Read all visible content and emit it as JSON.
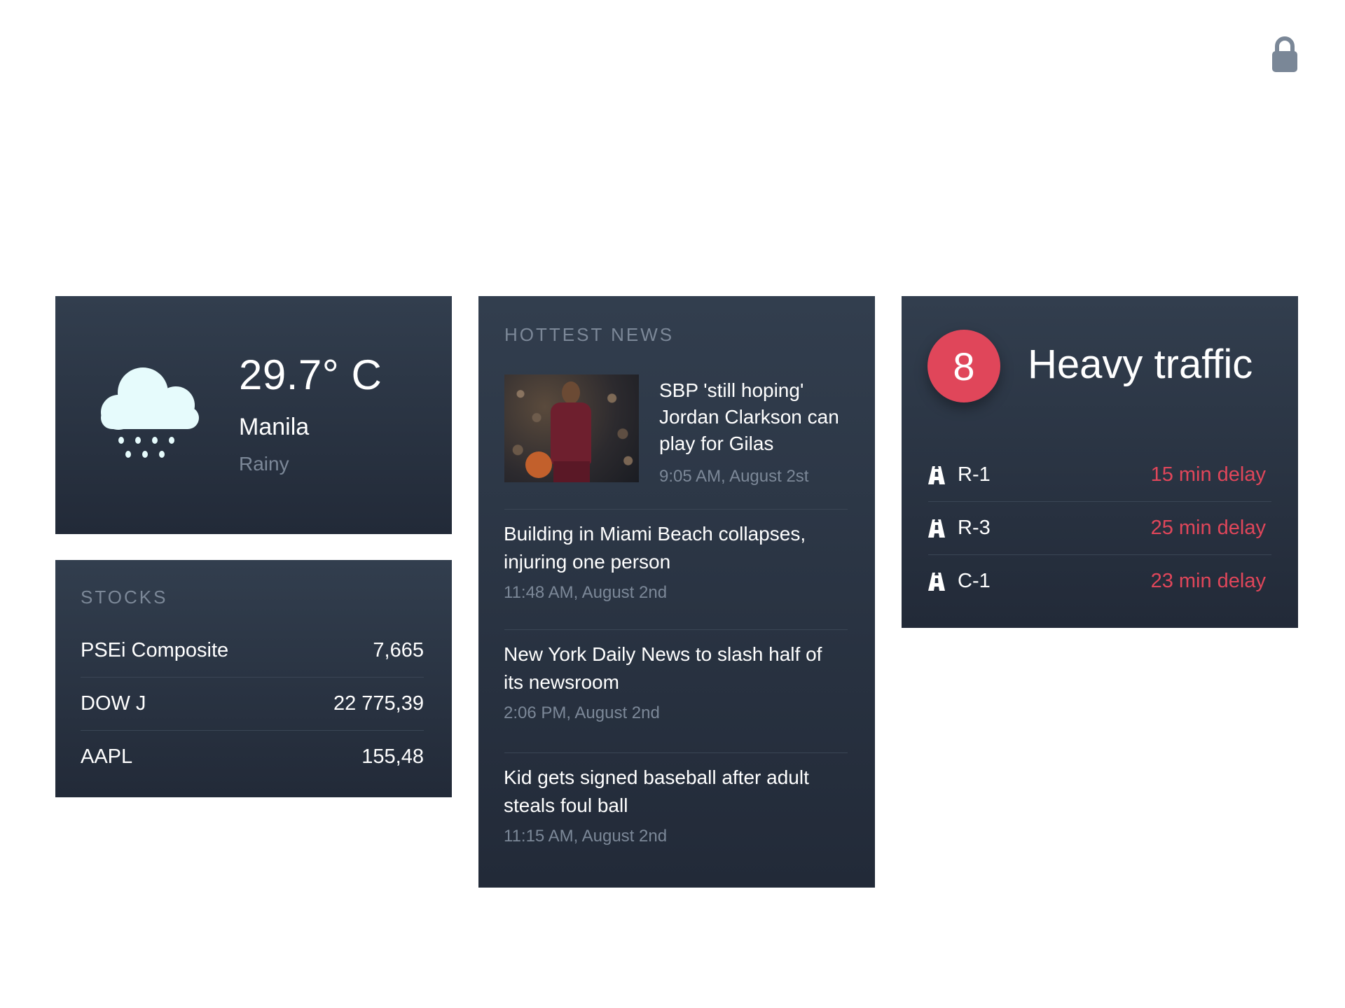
{
  "weather": {
    "temperature": "29.7° C",
    "city": "Manila",
    "condition": "Rainy",
    "icon": "rain-cloud-icon"
  },
  "stocks": {
    "title": "STOCKS",
    "items": [
      {
        "name": "PSEi Composite",
        "value": "7,665"
      },
      {
        "name": "DOW J",
        "value": "22 775,39"
      },
      {
        "name": "AAPL",
        "value": "155,48"
      }
    ]
  },
  "news": {
    "title": "HOTTEST NEWS",
    "featured": {
      "headline": "SBP 'still hoping' Jordan Clarkson can play for Gilas",
      "time": "9:05 AM, August 2st"
    },
    "items": [
      {
        "headline": "Building in Miami Beach collapses, injuring one person",
        "time": "11:48 AM, August 2nd"
      },
      {
        "headline": "New York Daily News to slash half of its newsroom",
        "time": "2:06 PM, August 2nd"
      },
      {
        "headline": "Kid gets signed baseball after adult steals foul ball",
        "time": "11:15 AM, August 2nd"
      }
    ]
  },
  "traffic": {
    "level": "8",
    "status": "Heavy traffic",
    "roads": [
      {
        "name": "R-1",
        "delay": "15 min delay"
      },
      {
        "name": "R-3",
        "delay": "25 min delay"
      },
      {
        "name": "C-1",
        "delay": "23 min delay"
      }
    ]
  },
  "colors": {
    "card_top": "#323e4e",
    "card_bottom": "#222a38",
    "accent_red": "#e0465a",
    "muted_text": "#7c8898",
    "lock": "#7a8797"
  }
}
